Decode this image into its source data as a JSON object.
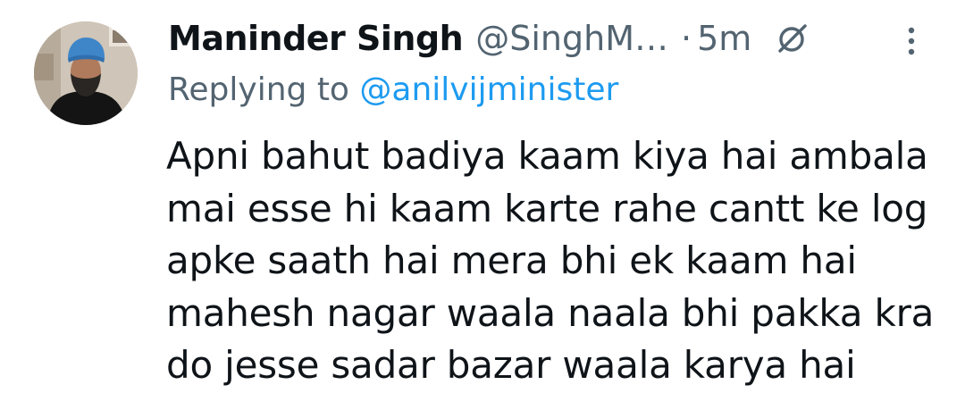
{
  "tweet": {
    "author": {
      "display_name": "Maninder Singh",
      "handle": "@SinghM…"
    },
    "separator": "·",
    "timestamp": "5m",
    "replying_prefix": "Replying to",
    "replying_to": "@anilvijminister",
    "text": "Apni bahut badiya kaam kiya hai ambala\nmai esse hi kaam karte rahe cantt ke log\napke saath hai mera bhi ek kaam hai\nmahesh nagar waala naala bhi pakka kra\ndo jesse sadar bazar waala karya hai"
  },
  "icons": {
    "grok": "grok-icon",
    "more": "more-vertical-icon"
  },
  "colors": {
    "primary_text": "#0f1419",
    "secondary_text": "#536471",
    "link": "#1d9bf0",
    "background": "#ffffff"
  }
}
